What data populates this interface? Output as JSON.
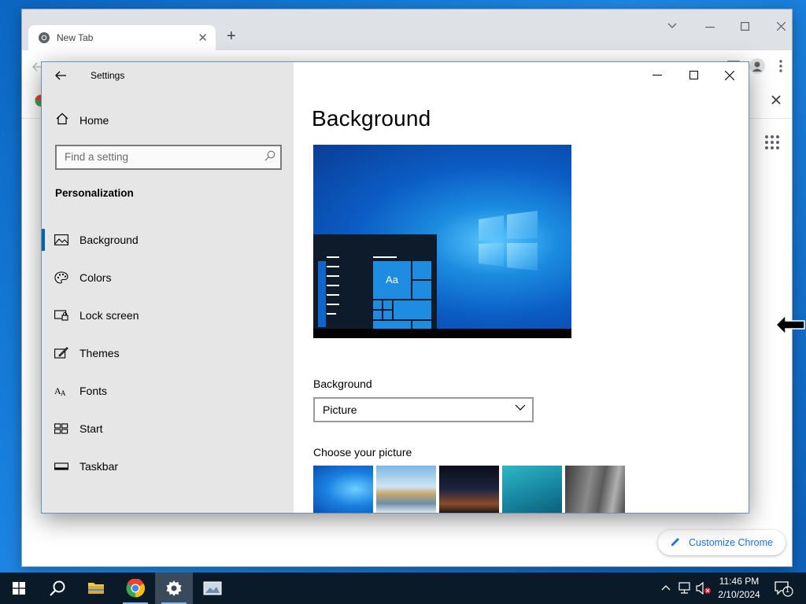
{
  "chrome": {
    "tab_title": "New Tab",
    "tab_close": "✕",
    "new_tab": "+",
    "customize_label": "Customize Chrome"
  },
  "settings": {
    "app_title": "Settings",
    "home_label": "Home",
    "search_placeholder": "Find a setting",
    "section_heading": "Personalization",
    "nav_items": [
      {
        "label": "Background",
        "icon": "picture-icon",
        "active": true
      },
      {
        "label": "Colors",
        "icon": "palette-icon",
        "active": false
      },
      {
        "label": "Lock screen",
        "icon": "lock-screen-icon",
        "active": false
      },
      {
        "label": "Themes",
        "icon": "themes-icon",
        "active": false
      },
      {
        "label": "Fonts",
        "icon": "fonts-icon",
        "active": false
      },
      {
        "label": "Start",
        "icon": "start-icon",
        "active": false
      },
      {
        "label": "Taskbar",
        "icon": "taskbar-icon",
        "active": false
      }
    ],
    "page_title": "Background",
    "preview_tile_text": "Aa",
    "background_label": "Background",
    "background_value": "Picture",
    "choose_picture_label": "Choose your picture",
    "accent_color": "#0063b1"
  },
  "taskbar": {
    "time": "11:46 PM",
    "date": "2/10/2024",
    "notification_count": "1",
    "apps": [
      "start-icon",
      "search-icon",
      "file-explorer-icon",
      "chrome-icon",
      "settings-icon",
      "photos-icon"
    ]
  }
}
